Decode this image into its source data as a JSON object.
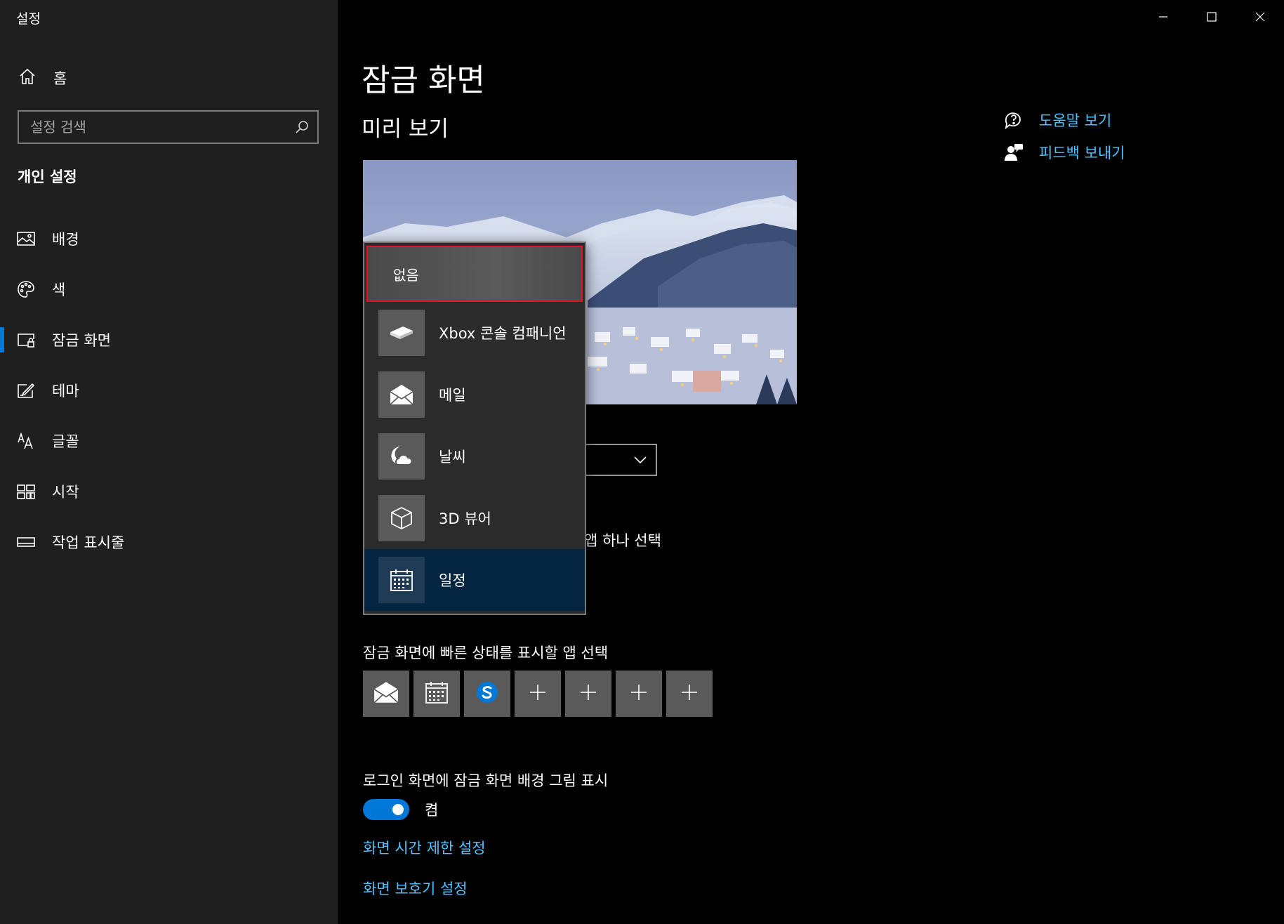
{
  "app": {
    "title": "설정"
  },
  "colors": {
    "accent": "#0078d7",
    "link": "#4cc2ff",
    "sidebar_bg": "#1f1f1f",
    "content_bg": "#000000",
    "focus_border": "#e81123"
  },
  "window_controls": {
    "minimize_icon": "minimize-icon",
    "maximize_icon": "maximize-icon",
    "close_icon": "close-icon"
  },
  "sidebar": {
    "home": {
      "label": "홈",
      "icon": "home-icon"
    },
    "search": {
      "placeholder": "설정 검색",
      "icon": "search-icon"
    },
    "section": "개인 설정",
    "items": [
      {
        "label": "배경",
        "icon": "picture-icon",
        "active": false
      },
      {
        "label": "색",
        "icon": "palette-icon",
        "active": false
      },
      {
        "label": "잠금 화면",
        "icon": "lock-screen-icon",
        "active": true
      },
      {
        "label": "테마",
        "icon": "theme-icon",
        "active": false
      },
      {
        "label": "글꼴",
        "icon": "font-icon",
        "active": false
      },
      {
        "label": "시작",
        "icon": "start-icon",
        "active": false
      },
      {
        "label": "작업 표시줄",
        "icon": "taskbar-icon",
        "active": false
      }
    ]
  },
  "main": {
    "title": "잠금 화면",
    "preview_heading": "미리 보기",
    "detailed_status_label_partial": "앱 하나 선택",
    "quick_status_label": "잠금 화면에 빠른 상태를 표시할 앱 선택",
    "quick_status_tiles": [
      "mail-icon",
      "calendar-icon",
      "skype-icon",
      "plus-icon",
      "plus-icon",
      "plus-icon",
      "plus-icon"
    ],
    "login_background_label": "로그인 화면에 잠금 화면 배경 그림 표시",
    "login_background_toggle": {
      "state": "켬",
      "on": true
    },
    "links": [
      "화면 시간 제한 설정",
      "화면 보호기 설정"
    ]
  },
  "help": {
    "items": [
      {
        "label": "도움말 보기",
        "icon": "help-icon"
      },
      {
        "label": "피드백 보내기",
        "icon": "feedback-icon"
      }
    ]
  },
  "popup": {
    "none_label": "없음",
    "items": [
      {
        "label": "Xbox 콘솔 컴패니언",
        "icon": "xbox-console-icon",
        "selected": false
      },
      {
        "label": "메일",
        "icon": "mail-icon",
        "selected": false
      },
      {
        "label": "날씨",
        "icon": "weather-icon",
        "selected": false
      },
      {
        "label": "3D 뷰어",
        "icon": "cube-icon",
        "selected": false
      },
      {
        "label": "일정",
        "icon": "calendar-icon",
        "selected": true
      }
    ]
  }
}
